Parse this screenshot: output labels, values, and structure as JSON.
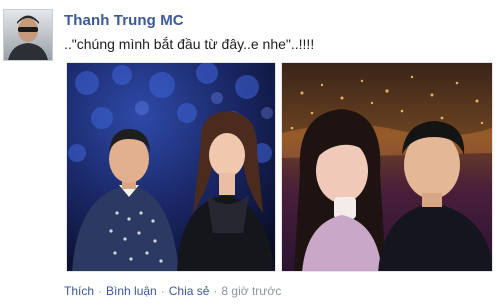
{
  "post": {
    "author": "Thanh Trung MC",
    "message": "..\"chúng mình bắt đầu từ đây..e nhe\"..!!!!",
    "actions": {
      "like": "Thích",
      "comment": "Bình luận",
      "share": "Chia sẻ",
      "separator": "·",
      "time": "8 giờ trước"
    }
  },
  "colors": {
    "link": "#3b5998",
    "meta": "#90949c"
  }
}
